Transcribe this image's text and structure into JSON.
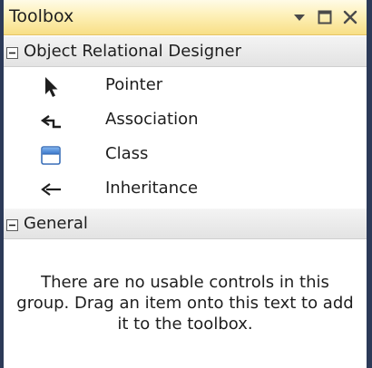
{
  "toolbox": {
    "title": "Toolbox",
    "controls": {
      "dropdown_icon": "chevron-down-icon",
      "maximize_icon": "maximize-icon",
      "close_icon": "close-icon"
    },
    "groups": [
      {
        "label": "Object Relational Designer",
        "expanded": true,
        "items": [
          {
            "label": "Pointer",
            "icon": "pointer-icon"
          },
          {
            "label": "Association",
            "icon": "association-icon"
          },
          {
            "label": "Class",
            "icon": "class-icon"
          },
          {
            "label": "Inheritance",
            "icon": "inheritance-icon"
          }
        ]
      },
      {
        "label": "General",
        "expanded": true,
        "empty_message": "There are no usable controls in this group. Drag an item onto this text to add it to the toolbox."
      }
    ]
  },
  "colors": {
    "title_gradient_top": "#fffbe6",
    "title_gradient_bottom": "#f8df86",
    "frame": "#2c3a58",
    "group_header": "#e9e9e9",
    "text": "#1e1e1e"
  }
}
